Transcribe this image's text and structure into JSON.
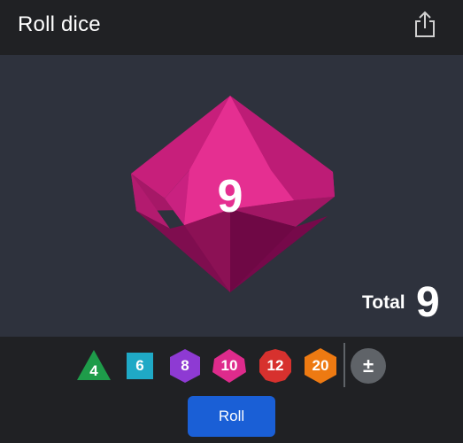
{
  "header": {
    "title": "Roll dice",
    "share_icon": "share-icon"
  },
  "die": {
    "sides": 10,
    "face_value": "9",
    "color": "#e22c8c"
  },
  "total": {
    "label": "Total",
    "value": "9"
  },
  "dice_buttons": [
    {
      "sides": "4",
      "shape": "triangle",
      "color": "#1e9c4a"
    },
    {
      "sides": "6",
      "shape": "square",
      "color": "#1fa9c6"
    },
    {
      "sides": "8",
      "shape": "hexagon",
      "color": "#8e3ad3"
    },
    {
      "sides": "10",
      "shape": "diamond-hex",
      "color": "#de2b8c"
    },
    {
      "sides": "12",
      "shape": "decagon",
      "color": "#d7312e"
    },
    {
      "sides": "20",
      "shape": "hexagon",
      "color": "#ee7a12"
    }
  ],
  "modifier": {
    "label": "±",
    "color": "#5f6368"
  },
  "roll_button": {
    "label": "Roll",
    "color": "#1a5fd6"
  }
}
